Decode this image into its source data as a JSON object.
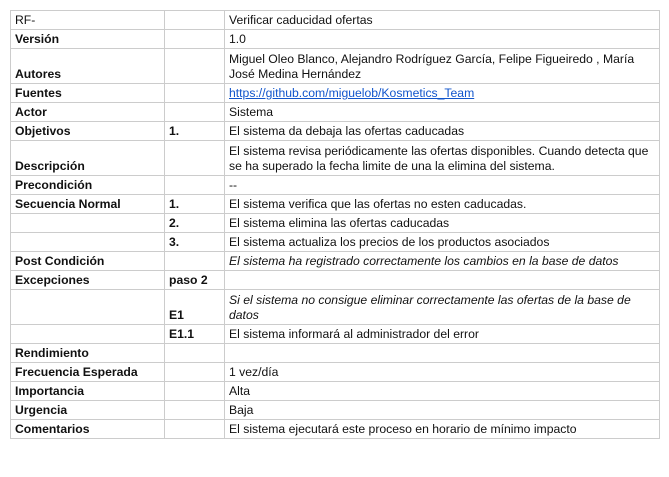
{
  "rows": {
    "rf": {
      "label": "RF-",
      "value": "Verificar caducidad ofertas"
    },
    "version": {
      "label": "Versión",
      "value": "1.0"
    },
    "autores": {
      "label": "Autores",
      "value": "Miguel Oleo Blanco, Alejandro Rodríguez García, Felipe Figueiredo , María José Medina Hernández"
    },
    "fuentes": {
      "label": "Fuentes",
      "link": "https://github.com/miguelob/Kosmetics_Team"
    },
    "actor": {
      "label": "Actor",
      "value": "Sistema"
    },
    "objetivos": {
      "label": "Objetivos",
      "num": "1.",
      "value": "El sistema da debaja las ofertas caducadas"
    },
    "descripcion": {
      "label": "Descripción",
      "value": "El sistema revisa periódicamente las ofertas disponibles. Cuando detecta que se ha superado la fecha limite de una la elimina del sistema."
    },
    "precondicion": {
      "label": "Precondición",
      "value": "--"
    },
    "secuencia": {
      "label": "Secuencia Normal",
      "steps": [
        {
          "num": "1.",
          "text": "El sistema verifica que las ofertas no esten caducadas."
        },
        {
          "num": "2.",
          "text": "El sistema elimina las ofertas caducadas"
        },
        {
          "num": "3.",
          "text": "El sistema actualiza los precios de los productos asociados"
        }
      ]
    },
    "postcondicion": {
      "label": "Post Condición",
      "value": "El sistema ha registrado correctamente los cambios en la base de datos"
    },
    "excepciones": {
      "label": "Excepciones",
      "num": "paso 2",
      "items": [
        {
          "num": "E1",
          "text": "Si el sistema no consigue eliminar correctamente las ofertas de la base de datos"
        },
        {
          "num": "E1.1",
          "text": "El sistema informará al administrador del error"
        }
      ]
    },
    "rendimiento": {
      "label": "Rendimiento",
      "value": ""
    },
    "frecuencia": {
      "label": "Frecuencia Esperada",
      "value": "1 vez/día"
    },
    "importancia": {
      "label": "Importancia",
      "value": "Alta"
    },
    "urgencia": {
      "label": "Urgencia",
      "value": "Baja"
    },
    "comentarios": {
      "label": "Comentarios",
      "value": "El sistema ejecutará este proceso en horario de mínimo impacto"
    }
  }
}
